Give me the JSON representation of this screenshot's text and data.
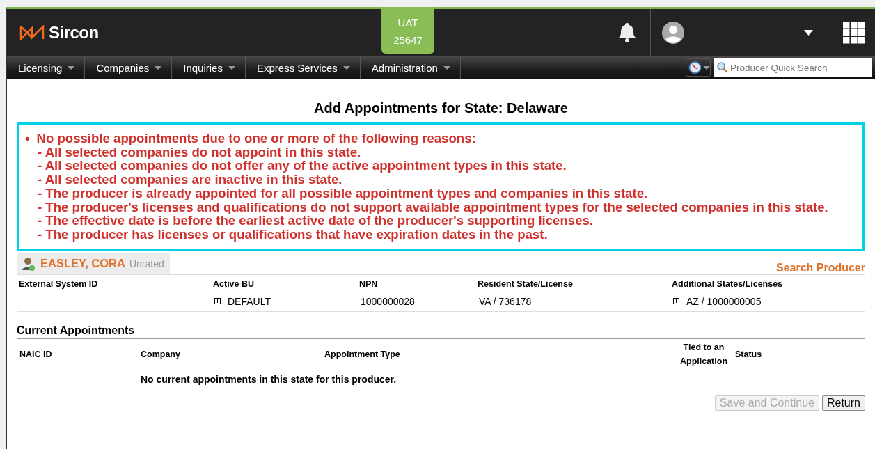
{
  "header": {
    "logo_text": "Sircon",
    "env_badge": {
      "line_1": "UAT",
      "line_2": "25647"
    }
  },
  "nav": {
    "menus": [
      {
        "label": "Licensing"
      },
      {
        "label": "Companies"
      },
      {
        "label": "Inquiries"
      },
      {
        "label": "Express Services"
      },
      {
        "label": "Administration"
      }
    ],
    "quick_search": {
      "placeholder": "Producer Quick Search"
    }
  },
  "page_title": "Add Appointments for State: Delaware",
  "message": {
    "bullet": "•",
    "heading": "No possible appointments due to one or more of the following reasons:",
    "reasons": [
      "- All selected companies do not appoint in this state.",
      "- All selected companies do not offer any of the active appointment types in this state.",
      "- All selected companies are inactive in this state.",
      "- The producer is already appointed for all possible appointment types and companies in this state.",
      "- The producer's licenses and qualifications do not support available appointment types for the selected companies in this state.",
      "- The effective date is before the earliest active date of the producer's supporting licenses.",
      "- The producer has licenses or qualifications that have expiration dates in the past."
    ]
  },
  "producer": {
    "name": "EASLEY, CORA",
    "rating": "Unrated",
    "search_link": "Search Producer",
    "fields": [
      {
        "label": "External System ID",
        "expandable": false
      },
      {
        "label": "Active BU",
        "value": "DEFAULT",
        "expandable": true
      },
      {
        "label": "NPN",
        "value": "1000000028",
        "expandable": false
      },
      {
        "label": "Resident State/License",
        "value": "VA / 736178",
        "expandable": false
      },
      {
        "label": "Additional States/Licenses",
        "value": "AZ / 1000000005",
        "expandable": true
      }
    ]
  },
  "appointments": {
    "title": "Current Appointments",
    "columns": [
      "NAIC ID",
      "Company",
      "Appointment Type",
      "Tied to an Application",
      "Status"
    ],
    "empty_message": "No current appointments in this state for this producer."
  },
  "buttons": [
    {
      "label": "Save and Continue",
      "disabled": true
    },
    {
      "label": "Return",
      "disabled": false
    }
  ]
}
